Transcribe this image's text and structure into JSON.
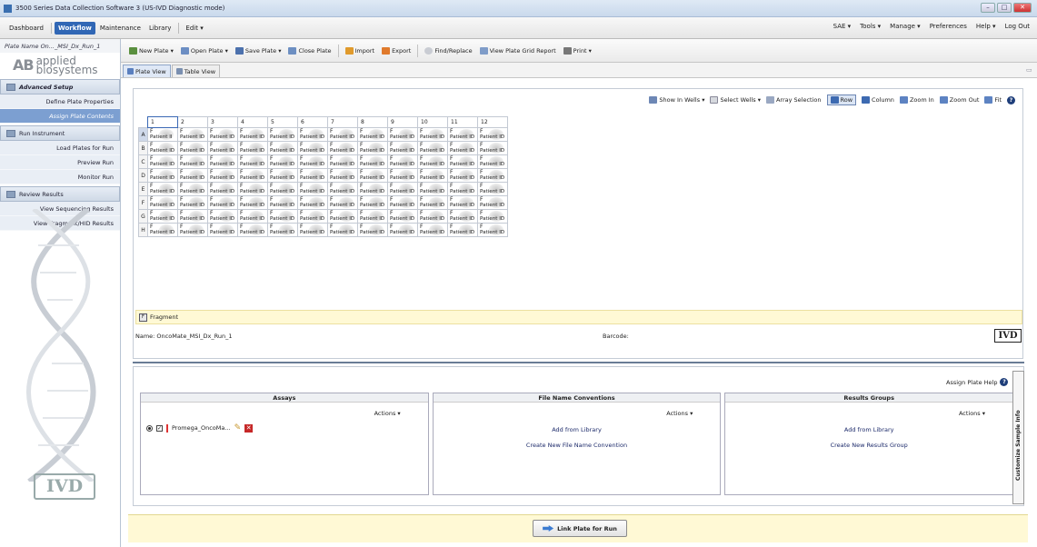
{
  "window": {
    "title": "3500 Series Data Collection Software 3 (US-IVD Diagnostic mode)"
  },
  "menu": {
    "items": [
      "Dashboard",
      "Workflow",
      "Maintenance",
      "Library",
      "Edit ▾"
    ],
    "right": [
      "SAE ▾",
      "Tools ▾",
      "Manage ▾",
      "Preferences",
      "Help ▾",
      "Log Out"
    ]
  },
  "sidebar": {
    "plate_name": "Plate Name On..._MSI_Dx_Run_1",
    "logo_text": "applied biosystems",
    "logo_mark": "AB",
    "sections": [
      {
        "label": "Advanced Setup",
        "items": [
          "Define Plate Properties",
          "Assign Plate Contents"
        ]
      },
      {
        "label": "Run Instrument",
        "items": [
          "Load Plates for Run",
          "Preview Run",
          "Monitor Run"
        ]
      },
      {
        "label": "Review Results",
        "items": [
          "View Sequencing Results",
          "View Fragment/HID Results"
        ]
      }
    ],
    "ivd_logo": "IVD"
  },
  "toolbar": {
    "new_plate": "New Plate ▾",
    "open_plate": "Open Plate ▾",
    "save_plate": "Save Plate ▾",
    "close_plate": "Close Plate",
    "import": "Import",
    "export": "Export",
    "find_replace": "Find/Replace",
    "grid_report": "View Plate Grid Report",
    "print": "Print ▾"
  },
  "tabs": [
    "Plate View",
    "Table View"
  ],
  "viewbar": {
    "show_in_wells": "Show In Wells ▾",
    "select_wells": "Select Wells ▾",
    "array_selection": "Array Selection",
    "row": "Row",
    "column": "Column",
    "zoom_in": "Zoom In",
    "zoom_out": "Zoom Out",
    "fit": "Fit"
  },
  "plate": {
    "columns": [
      "1",
      "2",
      "3",
      "4",
      "5",
      "6",
      "7",
      "8",
      "9",
      "10",
      "11",
      "12"
    ],
    "rows": [
      "A",
      "B",
      "C",
      "D",
      "E",
      "F",
      "G",
      "H"
    ],
    "well_type": "F",
    "well_label": "Patient ID",
    "well_label_a1": "Patient II"
  },
  "legend": {
    "marker": "F",
    "label": "Fragment"
  },
  "plate_info": {
    "name": "Name: OncoMate_MSI_Dx_Run_1",
    "barcode": "Barcode:",
    "ivd": "IVD"
  },
  "assign": {
    "help": "Assign Plate Help",
    "assays": {
      "title": "Assays",
      "actions": "Actions ▾",
      "item": "Promega_OncoMa...",
      "item_checked": "✓"
    },
    "file_names": {
      "title": "File Name Conventions",
      "actions": "Actions ▾",
      "add": "Add from Library",
      "create": "Create New File Name Convention"
    },
    "results": {
      "title": "Results Groups",
      "actions": "Actions ▾",
      "add": "Add from Library",
      "create": "Create New Results Group"
    },
    "customize": "Customize Sample Info"
  },
  "link_button": "Link Plate for Run"
}
